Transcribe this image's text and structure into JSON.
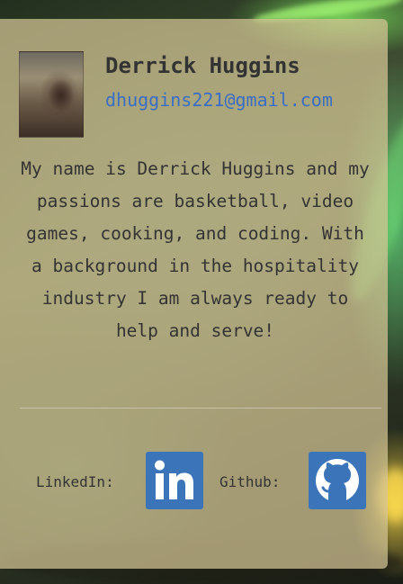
{
  "profile": {
    "name": "Derrick Huggins",
    "email": "dhuggins221@gmail.com",
    "bio": "My name is Derrick Huggins and my passions are basketball, video games, cooking, and coding. With a background in the hospitality industry I am always ready to help and serve!"
  },
  "social": {
    "linkedin_label": "LinkedIn:",
    "github_label": "Github:",
    "linkedin_icon": "linkedin-icon",
    "github_icon": "github-icon"
  },
  "colors": {
    "card_background": "#d6c696",
    "text": "#333333",
    "email_link": "#3a6ec4",
    "icon_background": "#3b74b8"
  }
}
